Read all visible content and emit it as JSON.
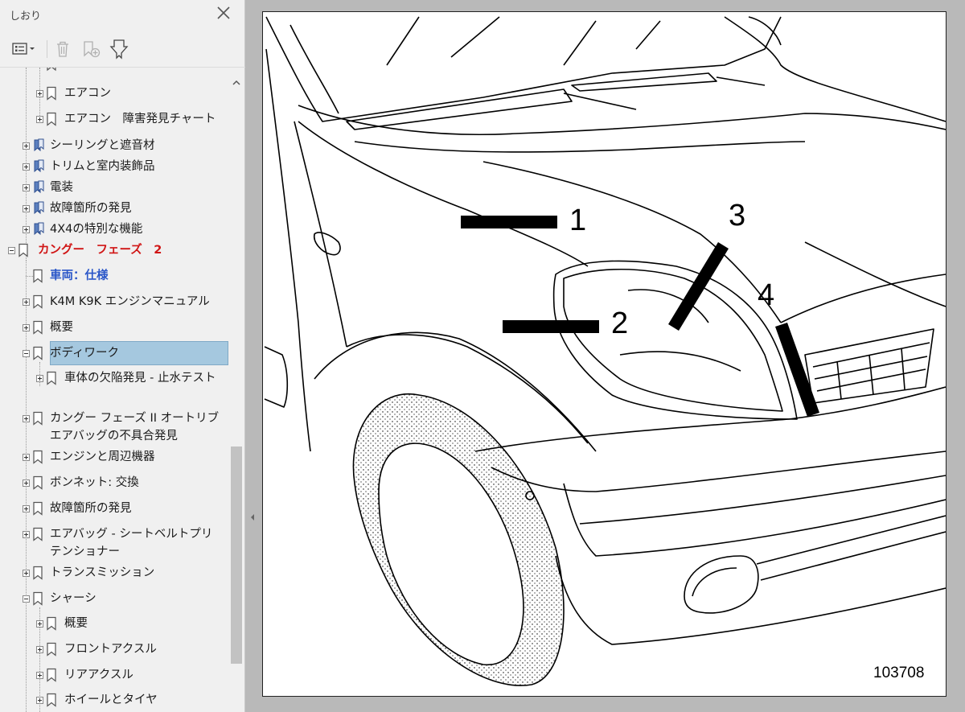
{
  "sidebar": {
    "title": "しおり",
    "toolbar": {
      "options_icon": "list-options-icon",
      "delete_icon": "trash-icon",
      "new_bookmark_icon": "new-bookmark-icon",
      "expand_icon": "bookmark-expand-icon"
    },
    "items": [
      {
        "label": "エアコン",
        "level": 2
      },
      {
        "label": "エアコン　障害発見チャート",
        "level": 2
      },
      {
        "label": "シーリングと遮音材",
        "level": 1
      },
      {
        "label": "トリムと室内装飾品",
        "level": 1
      },
      {
        "label": "電装",
        "level": 1
      },
      {
        "label": "故障箇所の発見",
        "level": 1
      },
      {
        "label": "4X4の特別な機能",
        "level": 1
      },
      {
        "label": "カングー　フェーズ　2",
        "level": 0
      },
      {
        "label": "車両：仕様",
        "level": 1
      },
      {
        "label": "K4M K9K エンジンマニュアル",
        "level": 1
      },
      {
        "label": "概要",
        "level": 1
      },
      {
        "label": "ボディワーク",
        "level": 1
      },
      {
        "label": "車体の欠陥発見 - 止水テスト",
        "level": 2
      },
      {
        "label": "カングー フェーズ II オートリブ エアバッグの不具合発見",
        "level": 1
      },
      {
        "label": "エンジンと周辺機器",
        "level": 1
      },
      {
        "label": "ボンネット: 交換",
        "level": 1
      },
      {
        "label": "故障箇所の発見",
        "level": 1
      },
      {
        "label": "エアバッグ - シートベルトプリテンショナー",
        "level": 1
      },
      {
        "label": "トランスミッション",
        "level": 1
      },
      {
        "label": "シャーシ",
        "level": 1
      },
      {
        "label": "概要",
        "level": 2
      },
      {
        "label": "フロントアクスル",
        "level": 2
      },
      {
        "label": "リアアクスル",
        "level": 2
      },
      {
        "label": "ホイールとタイヤ",
        "level": 2
      }
    ]
  },
  "page": {
    "callouts": [
      "1",
      "2",
      "3",
      "4"
    ],
    "reference_number": "103708"
  },
  "colors": {
    "selected_bg": "#a5c8df",
    "section_red": "#d01515",
    "link_blue": "#2a56c8"
  }
}
